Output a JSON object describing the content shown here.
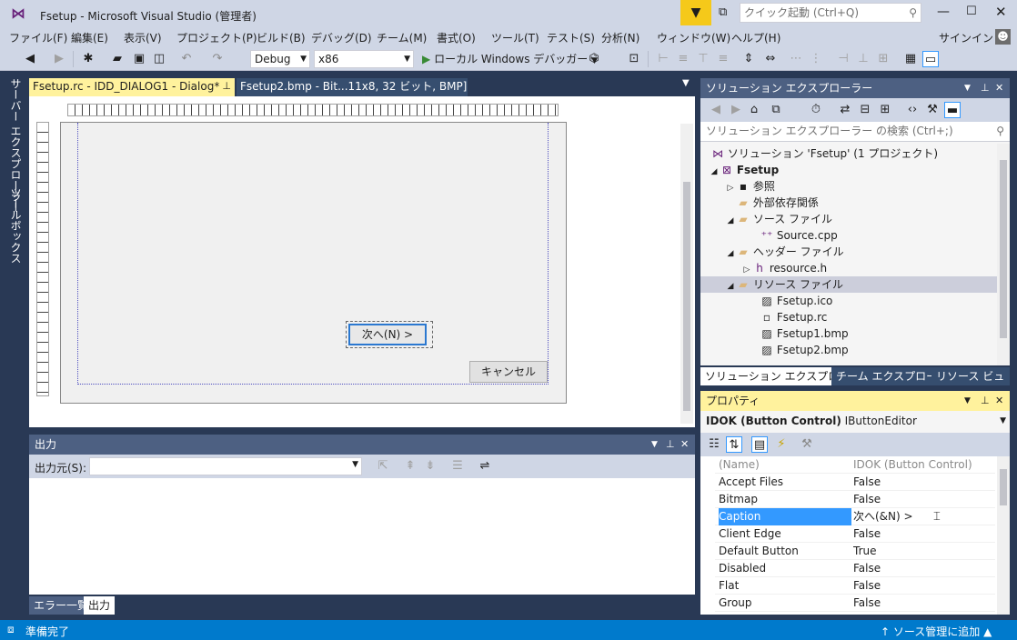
{
  "titlebar": {
    "title": "Fsetup - Microsoft Visual Studio (管理者)",
    "quick_launch_placeholder": "クイック起動 (Ctrl+Q)",
    "signin": "サインイン"
  },
  "menu": [
    "ファイル(F)",
    "編集(E)",
    "表示(V)",
    "プロジェクト(P)",
    "ビルド(B)",
    "デバッグ(D)",
    "チーム(M)",
    "書式(O)",
    "ツール(T)",
    "テスト(S)",
    "分析(N)",
    "ウィンドウ(W)",
    "ヘルプ(H)"
  ],
  "toolbar": {
    "config": "Debug",
    "platform": "x86",
    "debugger": "ローカル Windows デバッガー"
  },
  "left_tabs": [
    "サーバー エクスプローラー",
    "ツールボックス"
  ],
  "doc_tabs": [
    {
      "label": "Fsetup.rc - IDD_DIALOG1 - Dialog*"
    },
    {
      "label": "Fsetup2.bmp - Bit...11x8, 32 ビット, BMP]"
    }
  ],
  "dialog": {
    "next_button": "次へ(N) >",
    "cancel_button": "キャンセル"
  },
  "output": {
    "title": "出力",
    "source_label": "出力元(S):",
    "source_value": ""
  },
  "bottom_tabs": [
    "エラー一覧",
    "出力"
  ],
  "solution_explorer": {
    "title": "ソリューション エクスプローラー",
    "search_placeholder": "ソリューション エクスプローラー の検索 (Ctrl+;)",
    "tree": [
      {
        "label": "ソリューション 'Fsetup' (1 プロジェクト)",
        "indent": 0,
        "icon": "solution-icon",
        "expander": ""
      },
      {
        "label": "Fsetup",
        "indent": 1,
        "icon": "project-icon",
        "expander": "◢",
        "bold": true
      },
      {
        "label": "参照",
        "indent": 2,
        "icon": "references-icon",
        "expander": "▷"
      },
      {
        "label": "外部依存関係",
        "indent": 2,
        "icon": "folder-icon",
        "expander": ""
      },
      {
        "label": "ソース ファイル",
        "indent": 2,
        "icon": "folder-icon",
        "expander": "◢"
      },
      {
        "label": "Source.cpp",
        "indent": 3,
        "icon": "cpp-file-icon",
        "expander": ""
      },
      {
        "label": "ヘッダー ファイル",
        "indent": 2,
        "icon": "folder-icon",
        "expander": "◢"
      },
      {
        "label": "resource.h",
        "indent": 3,
        "icon": "header-file-icon",
        "expander": "▷"
      },
      {
        "label": "リソース ファイル",
        "indent": 2,
        "icon": "folder-icon",
        "expander": "◢",
        "selected": true
      },
      {
        "label": "Fsetup.ico",
        "indent": 3,
        "icon": "image-file-icon",
        "expander": ""
      },
      {
        "label": "Fsetup.rc",
        "indent": 3,
        "icon": "rc-file-icon",
        "expander": ""
      },
      {
        "label": "Fsetup1.bmp",
        "indent": 3,
        "icon": "image-file-icon",
        "expander": ""
      },
      {
        "label": "Fsetup2.bmp",
        "indent": 3,
        "icon": "image-file-icon",
        "expander": ""
      }
    ],
    "tabs": [
      "ソリューション エクスプローラー",
      "チーム エクスプローラー",
      "リソース ビュー"
    ]
  },
  "properties": {
    "title": "プロパティ",
    "object": "IDOK (Button Control)",
    "object_type": "IButtonEditor",
    "rows": [
      {
        "name": "(Name)",
        "value": "IDOK (Button Control)",
        "dim": true
      },
      {
        "name": "Accept Files",
        "value": "False"
      },
      {
        "name": "Bitmap",
        "value": "False"
      },
      {
        "name": "Caption",
        "value": "次へ(&N) >",
        "selected": true
      },
      {
        "name": "Client Edge",
        "value": "False"
      },
      {
        "name": "Default Button",
        "value": "True"
      },
      {
        "name": "Disabled",
        "value": "False"
      },
      {
        "name": "Flat",
        "value": "False"
      },
      {
        "name": "Group",
        "value": "False"
      }
    ]
  },
  "statusbar": {
    "left": "準備完了",
    "right": "ソース管理に追加"
  },
  "colors": {
    "frame": "#293955",
    "chrome": "#cfd6e5",
    "accent": "#007acc",
    "active_panel": "#fff29d",
    "selection": "#3399ff"
  }
}
